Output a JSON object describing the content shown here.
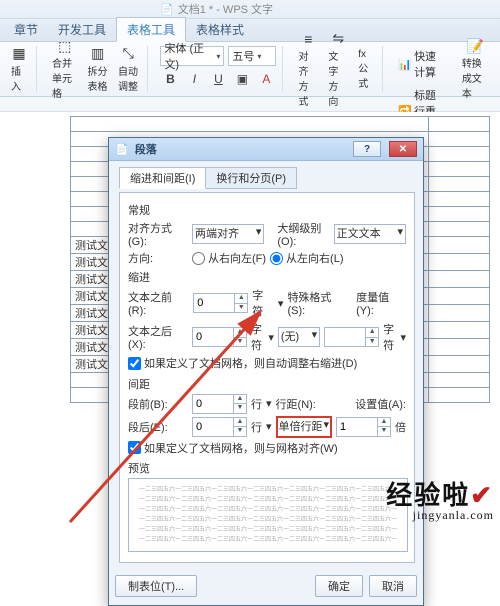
{
  "app": {
    "doc_icon": "📄",
    "doc_label": "文档1 * - WPS 文字"
  },
  "ribbon": {
    "tabs": [
      "章节",
      "开发工具",
      "表格工具",
      "表格样式"
    ],
    "active_tab": "表格工具",
    "insert_above_label": "插入",
    "merge_label": "合并单元格",
    "split_label": "拆分表格",
    "autofit_label": "自动调整",
    "font_combo": "宋体 (正文)",
    "size_combo": "五号",
    "align_label": "对齐方式",
    "textdir_label": "文字方向",
    "formula_label": "fx 公式",
    "fastcalc": "快速计算",
    "showtitle": "标题行重复",
    "convert": "转换成文本"
  },
  "table_cells": {
    "sample_text": "测试文字"
  },
  "dialog": {
    "title": "段落",
    "tab1": "缩进和间距(I)",
    "tab2": "换行和分页(P)",
    "sec_general": "常规",
    "align_label": "对齐方式(G):",
    "align_value": "两端对齐",
    "outline_label": "大纲级别(O):",
    "outline_value": "正文文本",
    "direction_label": "方向:",
    "dir_rtl": "从右向左(F)",
    "dir_ltr": "从左向右(L)",
    "sec_indent": "缩进",
    "text_before": "文本之前(R):",
    "text_before_v": "0",
    "char_unit": "字符",
    "special_label": "特殊格式(S):",
    "special_value": "(无)",
    "measure_label": "度量值(Y):",
    "text_after": "文本之后(X):",
    "text_after_v": "0",
    "auto_indent_chk": "如果定义了文档网格，则自动调整右缩进(D)",
    "sec_spacing": "间距",
    "space_before": "段前(B):",
    "space_before_v": "0",
    "line_unit": "行",
    "linespacing_label": "行距(N):",
    "linespacing_value": "单倍行距",
    "setvalue_label": "设置值(A):",
    "space_after": "段后(E):",
    "space_after_v": "0",
    "setvalue_v": "1",
    "bei_unit": "倍",
    "snap_grid_chk": "如果定义了文档网格，则与网格对齐(W)",
    "sec_preview": "预览",
    "preview_line": "一二三四五六一二三四五六一二三四五六一二三四五六一二三四五六一二三四五六一二三四五六一二三四五六一二三四五六",
    "tabs_btn": "制表位(T)...",
    "ok_btn": "确定",
    "cancel_btn": "取消"
  },
  "watermark": {
    "brand": "经验啦",
    "check": "✔",
    "url": "jingyanla.com"
  }
}
